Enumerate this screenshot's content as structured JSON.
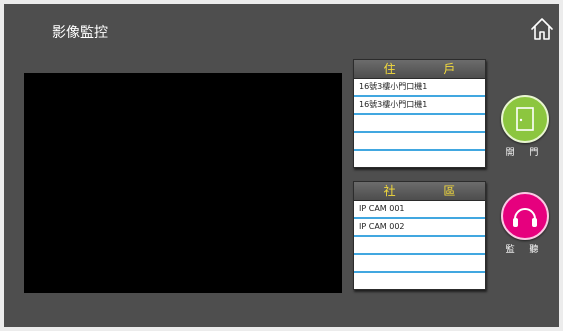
{
  "header": {
    "title": "影像監控",
    "home_icon": "home-icon"
  },
  "video": {
    "state": "blank"
  },
  "residents": {
    "header": "住 戶",
    "items": [
      "16號3樓小門口機1",
      "16號3樓小門口機1",
      "",
      "",
      ""
    ]
  },
  "community": {
    "header": "社 區",
    "items": [
      "IP CAM 001",
      "IP CAM 002",
      "",
      "",
      ""
    ]
  },
  "actions": {
    "open_door": {
      "label": "開 門",
      "icon": "door-icon",
      "color": "#8cc63f"
    },
    "monitor": {
      "label": "監 聽",
      "icon": "headset-icon",
      "color": "#e6007e"
    }
  },
  "colors": {
    "background": "#4e4e4e",
    "row_divider": "#41a7e0",
    "header_text": "#f5dc3c"
  }
}
